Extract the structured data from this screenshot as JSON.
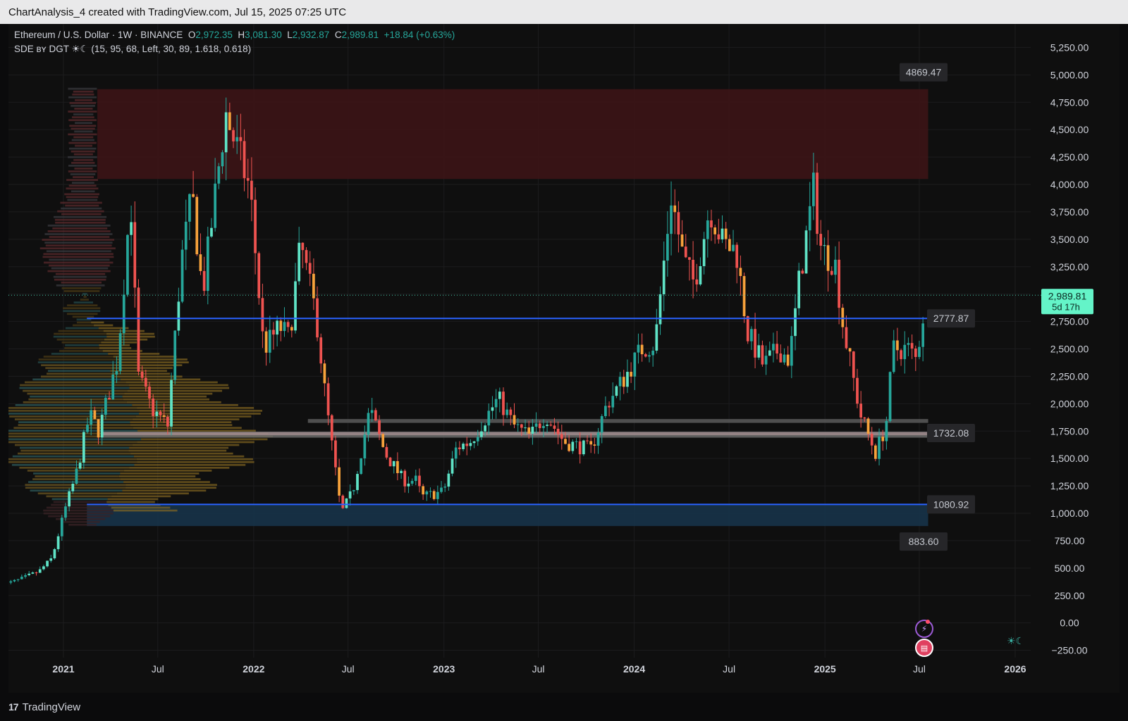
{
  "header": {
    "attribution": "ChartAnalysis_4 created with TradingView.com, Jul 15, 2025 07:25 UTC"
  },
  "legend": {
    "symbol": "Ethereum / U.S. Dollar · 1W · BINANCE",
    "o_label": "O",
    "o_value": "2,972.35",
    "h_label": "H",
    "h_value": "3,081.30",
    "l_label": "L",
    "l_value": "2,932.87",
    "c_label": "C",
    "c_value": "2,989.81",
    "change": "+18.84 (+0.63%)",
    "indicator": "SDE ʙʏ DGT ☀☾ (15, 95, 68, Left, 30, 89, 1.618, 0.618)"
  },
  "footer": {
    "brand": "TradingView",
    "brand_mark": "17"
  },
  "icons": {
    "alert": "lightning-icon",
    "flag": "us-flag-icon",
    "theme": "sun-moon-icon"
  },
  "colors": {
    "up": "#26a69a",
    "up_bright": "#5fe3c6",
    "down": "#ef5350",
    "orange": "#f7a23b",
    "axis_text": "#d1d4dc",
    "price_tag_bg": "#64f4c8",
    "level_blue": "#2962ff"
  },
  "chart_data": {
    "type": "candlestick",
    "title": "Ethereum / U.S. Dollar · 1W · BINANCE",
    "y_ticks": [
      "5,250.00",
      "5,000.00",
      "4,750.00",
      "4,500.00",
      "4,250.00",
      "4,000.00",
      "3,750.00",
      "3,500.00",
      "3,250.00",
      "3,000.00",
      "2,750.00",
      "2,500.00",
      "2,250.00",
      "2,000.00",
      "1,750.00",
      "1,500.00",
      "1,250.00",
      "1,000.00",
      "750.00",
      "500.00",
      "250.00",
      "0.00",
      "−250.00"
    ],
    "y_tick_values": [
      5250,
      5000,
      4750,
      4500,
      4250,
      4000,
      3750,
      3500,
      3250,
      3000,
      2750,
      2500,
      2250,
      2000,
      1750,
      1500,
      1250,
      1000,
      750,
      500,
      250,
      0,
      -250
    ],
    "x_ticks": [
      {
        "label": "2021",
        "date": "2021-01-01",
        "bold": true
      },
      {
        "label": "Jul",
        "date": "2021-07-01",
        "bold": false
      },
      {
        "label": "2022",
        "date": "2022-01-01",
        "bold": true
      },
      {
        "label": "Jul",
        "date": "2022-07-01",
        "bold": false
      },
      {
        "label": "2023",
        "date": "2023-01-01",
        "bold": true
      },
      {
        "label": "Jul",
        "date": "2023-07-01",
        "bold": false
      },
      {
        "label": "2024",
        "date": "2024-01-01",
        "bold": true
      },
      {
        "label": "Jul",
        "date": "2024-07-01",
        "bold": false
      },
      {
        "label": "2025",
        "date": "2025-01-01",
        "bold": true
      },
      {
        "label": "Jul",
        "date": "2025-07-01",
        "bold": false
      },
      {
        "label": "2026",
        "date": "2026-01-01",
        "bold": true
      }
    ],
    "xlim": [
      "2020-09-05",
      "2026-04-10"
    ],
    "ylim": [
      -310,
      5380
    ],
    "current_price": {
      "value": 2989.81,
      "label": "2,989.81",
      "countdown": "5d 17h"
    },
    "levels": [
      {
        "value": 4869.47,
        "label": "4869.47",
        "kind": "zone-top"
      },
      {
        "value": 2777.87,
        "label": "2777.87",
        "kind": "blue-line"
      },
      {
        "value": 1732.08,
        "label": "1732.08",
        "kind": "gray-band"
      },
      {
        "value": 1080.92,
        "label": "1080.92",
        "kind": "blue-line"
      },
      {
        "value": 883.6,
        "label": "883.60",
        "kind": "zone-bottom"
      }
    ],
    "zones": [
      {
        "name": "supply",
        "from": 4050,
        "to": 4869.47,
        "start": "2021-03-07",
        "end": "2025-07-18",
        "color": "#3a1416"
      },
      {
        "name": "demand",
        "from": 883.6,
        "to": 1080.92,
        "start": "2021-02-15",
        "end": "2025-07-18",
        "color": "#173247"
      }
    ],
    "bands": [
      {
        "from": 1825,
        "to": 1860,
        "start": "2022-04-15",
        "end": "2025-07-18",
        "color": "#5a5a5a"
      },
      {
        "from": 1690,
        "to": 1745,
        "start": "2021-03-15",
        "end": "2025-07-18",
        "color": "#6a6a6a"
      }
    ],
    "poc": {
      "from": 1712,
      "to": 1740,
      "color": "#c9a8ac"
    },
    "anchor_points": [
      [
        "2020-09-08",
        350
      ],
      [
        "2020-10-05",
        390
      ],
      [
        "2020-11-15",
        470
      ],
      [
        "2020-12-10",
        590
      ],
      [
        "2021-01-05",
        1050
      ],
      [
        "2021-01-25",
        1350
      ],
      [
        "2021-02-20",
        1900
      ],
      [
        "2021-03-10",
        1750
      ],
      [
        "2021-04-15",
        2400
      ],
      [
        "2021-05-10",
        3900
      ],
      [
        "2021-05-24",
        2250
      ],
      [
        "2021-06-20",
        1950
      ],
      [
        "2021-07-20",
        1800
      ],
      [
        "2021-08-15",
        3300
      ],
      [
        "2021-09-05",
        3900
      ],
      [
        "2021-09-25",
        3000
      ],
      [
        "2021-11-08",
        4650
      ],
      [
        "2021-12-05",
        4250
      ],
      [
        "2021-12-25",
        3950
      ],
      [
        "2022-01-20",
        2500
      ],
      [
        "2022-02-20",
        2700
      ],
      [
        "2022-03-10",
        2600
      ],
      [
        "2022-04-01",
        3450
      ],
      [
        "2022-05-01",
        2800
      ],
      [
        "2022-05-20",
        2000
      ],
      [
        "2022-06-18",
        1000
      ],
      [
        "2022-07-10",
        1200
      ],
      [
        "2022-08-12",
        1950
      ],
      [
        "2022-09-10",
        1550
      ],
      [
        "2022-10-15",
        1300
      ],
      [
        "2022-11-08",
        1300
      ],
      [
        "2022-11-20",
        1150
      ],
      [
        "2022-12-31",
        1200
      ],
      [
        "2023-01-25",
        1600
      ],
      [
        "2023-02-20",
        1650
      ],
      [
        "2023-04-15",
        2050
      ],
      [
        "2023-05-15",
        1800
      ],
      [
        "2023-06-15",
        1700
      ],
      [
        "2023-07-15",
        1900
      ],
      [
        "2023-08-20",
        1650
      ],
      [
        "2023-10-10",
        1580
      ],
      [
        "2023-11-10",
        2000
      ],
      [
        "2023-12-15",
        2250
      ],
      [
        "2024-01-15",
        2500
      ],
      [
        "2024-02-10",
        2550
      ],
      [
        "2024-03-12",
        3900
      ],
      [
        "2024-04-05",
        3300
      ],
      [
        "2024-04-25",
        3100
      ],
      [
        "2024-05-25",
        3800
      ],
      [
        "2024-06-20",
        3450
      ],
      [
        "2024-07-15",
        3400
      ],
      [
        "2024-08-05",
        2650
      ],
      [
        "2024-09-05",
        2350
      ],
      [
        "2024-10-05",
        2500
      ],
      [
        "2024-10-25",
        2400
      ],
      [
        "2024-11-12",
        3100
      ],
      [
        "2024-12-10",
        3950
      ],
      [
        "2024-12-25",
        3400
      ],
      [
        "2025-01-20",
        3300
      ],
      [
        "2025-02-05",
        2700
      ],
      [
        "2025-03-10",
        1900
      ],
      [
        "2025-04-08",
        1550
      ],
      [
        "2025-04-28",
        1800
      ],
      [
        "2025-05-12",
        2500
      ],
      [
        "2025-06-10",
        2500
      ],
      [
        "2025-06-25",
        2400
      ],
      [
        "2025-07-14",
        2989.81
      ]
    ]
  }
}
